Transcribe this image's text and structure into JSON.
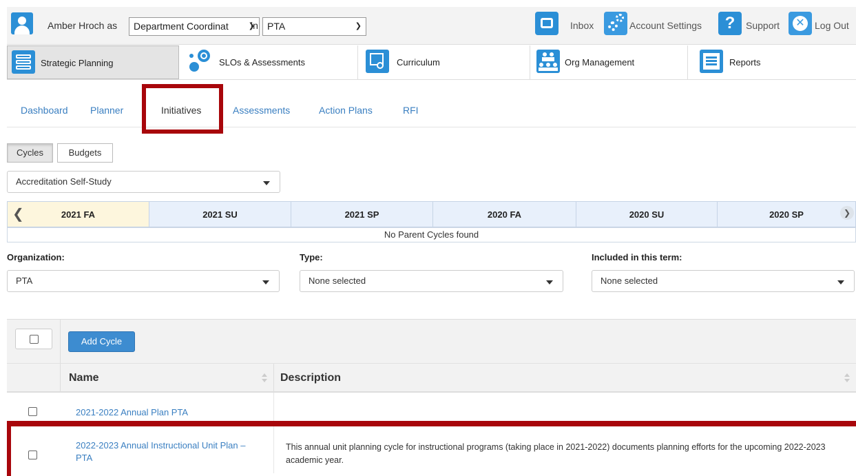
{
  "user": {
    "name": "Amber Hroch",
    "as_word": "as",
    "role_select": "Department Coordinat",
    "in_word": "in",
    "unit_select": "PTA"
  },
  "top_links": {
    "inbox": "Inbox",
    "account_settings": "Account Settings",
    "support": "Support",
    "logout": "Log Out"
  },
  "modules": [
    {
      "label": "Strategic Planning",
      "icon": "strategic-planning-icon"
    },
    {
      "label": "SLOs & Assessments",
      "icon": "slo-target-icon"
    },
    {
      "label": "Curriculum",
      "icon": "curriculum-icon"
    },
    {
      "label": "Org Management",
      "icon": "org-people-icon"
    },
    {
      "label": "Reports",
      "icon": "reports-icon"
    }
  ],
  "subnav": [
    "Dashboard",
    "Planner",
    "Initiatives",
    "Assessments",
    "Action Plans",
    "RFI"
  ],
  "view_toggle": {
    "cycles": "Cycles",
    "budgets": "Budgets"
  },
  "cycle_type_select": "Accreditation Self-Study",
  "cycles": [
    "2021 FA",
    "2021 SU",
    "2021 SP",
    "2020 FA",
    "2020 SU",
    "2020 SP"
  ],
  "no_parent_message": "No Parent Cycles found",
  "filters": {
    "organization": {
      "label": "Organization:",
      "value": "PTA"
    },
    "type": {
      "label": "Type:",
      "value": "None selected"
    },
    "included": {
      "label": "Included in this term:",
      "value": "None selected"
    }
  },
  "table": {
    "add_button": "Add Cycle",
    "columns": [
      "Name",
      "Description"
    ],
    "rows": [
      {
        "name": "2021-2022 Annual Plan PTA",
        "description": ""
      },
      {
        "name": "2022-2023 Annual Instructional Unit Plan – PTA",
        "description": "This annual unit planning cycle for instructional programs (taking place in 2021-2022) documents planning efforts for the upcoming 2022-2023 academic year."
      }
    ]
  },
  "colors": {
    "accent_blue": "#2b8fd6",
    "link_blue": "#3a7fc1",
    "highlight_red": "#a8060b",
    "active_cycle_bg": "#fdf6dd"
  }
}
